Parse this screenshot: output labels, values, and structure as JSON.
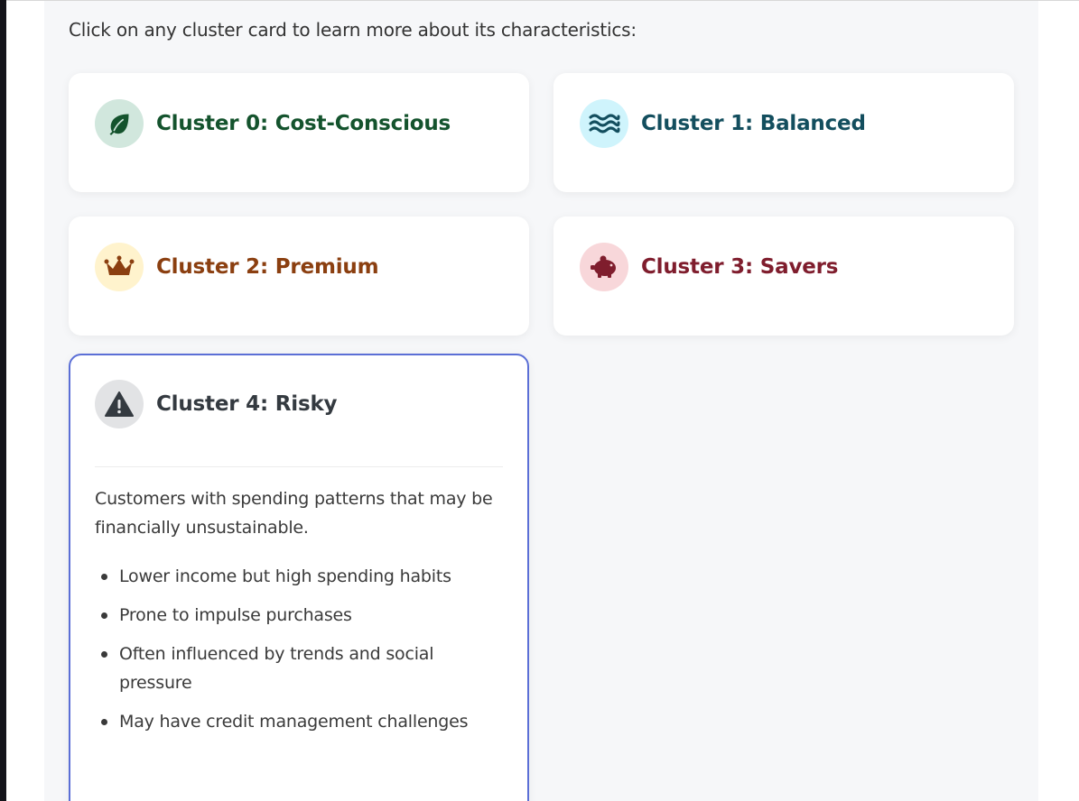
{
  "intro": "Click on any cluster card to learn more about its characteristics:",
  "clusters": [
    {
      "title": "Cluster 0: Cost-Conscious",
      "icon": "leaf-icon",
      "color": "#14532d",
      "icon_bg": "#d1e7dd"
    },
    {
      "title": "Cluster 1: Balanced",
      "icon": "water-waves-icon",
      "color": "#134e5e",
      "icon_bg": "#cff4fc"
    },
    {
      "title": "Cluster 2: Premium",
      "icon": "crown-icon",
      "color": "#8b3f10",
      "icon_bg": "#fff3cd"
    },
    {
      "title": "Cluster 3: Savers",
      "icon": "piggy-bank-icon",
      "color": "#7f1d2d",
      "icon_bg": "#f8d7da"
    },
    {
      "title": "Cluster 4: Risky",
      "icon": "warning-icon",
      "color": "#343a40",
      "icon_bg": "#e2e3e5",
      "expanded": true,
      "description": "Customers with spending patterns that may be financially unsustainable.",
      "traits": [
        "Lower income but high spending habits",
        "Prone to impulse purchases",
        "Often influenced by trends and social pressure",
        "May have credit management challenges"
      ]
    }
  ]
}
